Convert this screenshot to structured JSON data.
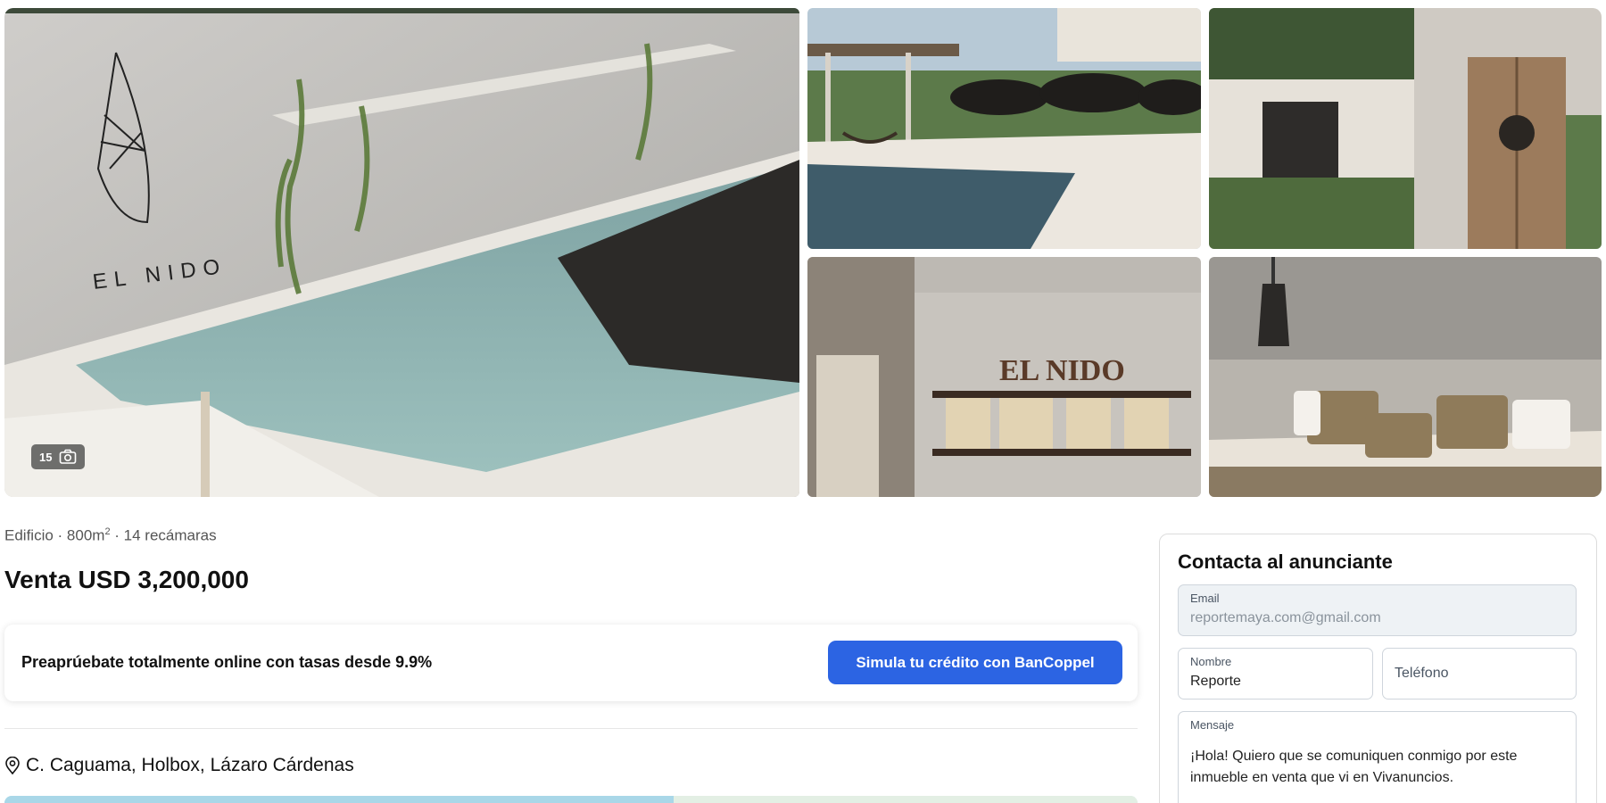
{
  "gallery": {
    "photo_count": "15",
    "photos": [
      {
        "subject": "pool-with-wall-sign",
        "sign_text": "EL NIDO"
      },
      {
        "subject": "pool-terrace-umbrellas"
      },
      {
        "subject": "wooden-door-entrance"
      },
      {
        "subject": "bookshelf-sign",
        "sign_text": "EL NIDO"
      },
      {
        "subject": "bedroom-pillows"
      }
    ],
    "icons": {
      "photo_count": "camera-icon"
    }
  },
  "listing": {
    "specs_prefix": "Edificio · 800m",
    "specs_sup": "2",
    "specs_suffix": " · 14 recámaras",
    "price": "Venta USD 3,200,000",
    "address": "C. Caguama, Holbox, Lázaro Cárdenas",
    "address_icon": "location-pin-icon"
  },
  "credit": {
    "text": "Preaprúebate totalmente online con tasas desde 9.9%",
    "button_label": "Simula tu crédito con BanCoppel",
    "button_color": "#2c64e3"
  },
  "contact": {
    "title": "Contacta al anunciante",
    "email_label": "Email",
    "email_value": "reportemaya.com@gmail.com",
    "nombre_label": "Nombre",
    "nombre_value": "Reporte",
    "telefono_placeholder": "Teléfono",
    "mensaje_label": "Mensaje",
    "mensaje_value": "¡Hola! Quiero que se comuniquen conmigo por este inmueble en venta que vi en Vivanuncios."
  }
}
